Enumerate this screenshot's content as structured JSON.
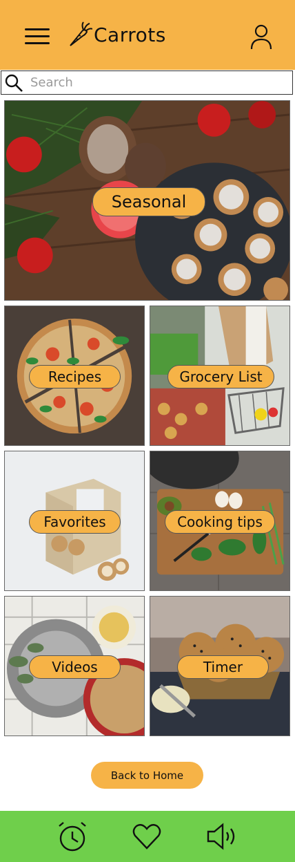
{
  "app": {
    "title": "Carrots",
    "colors": {
      "header": "#f6b347",
      "footer": "#6fcf4b",
      "pill": "#f6b347"
    }
  },
  "header": {
    "menu_icon": "hamburger-icon",
    "logo_icon": "carrot-icon",
    "user_icon": "user-icon"
  },
  "search": {
    "placeholder": "Search",
    "value": "",
    "icon": "search-icon"
  },
  "tiles": [
    {
      "label": "Seasonal"
    },
    {
      "label": "Recipes"
    },
    {
      "label": "Grocery List"
    },
    {
      "label": "Favorites"
    },
    {
      "label": "Cooking tips"
    },
    {
      "label": "Videos"
    },
    {
      "label": "Timer"
    }
  ],
  "back_button": {
    "label": "Back to Home"
  },
  "footer": {
    "icons": [
      "alarm-clock-icon",
      "heart-icon",
      "speaker-icon"
    ]
  }
}
